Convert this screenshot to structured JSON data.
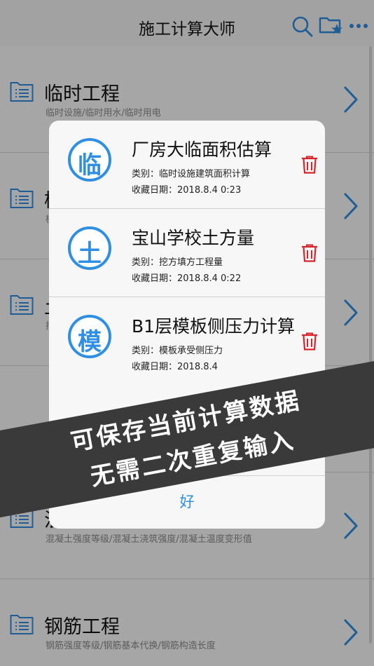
{
  "nav": {
    "title": "施工计算大师",
    "icons": [
      "search-icon",
      "folder-star-icon",
      "more-icon"
    ]
  },
  "list": [
    {
      "title": "临时工程",
      "subtitle": "临时设施/临时用水/临时用电"
    },
    {
      "title": "模",
      "subtitle": "模"
    },
    {
      "title": "土",
      "subtitle": "挖"
    },
    {
      "title": "",
      "subtitle": ""
    },
    {
      "title": "混",
      "subtitle": "混凝土强度等级/混凝土浇筑强度/混凝土温度变形值"
    },
    {
      "title": "钢筋工程",
      "subtitle": "钢筋强度等级/钢筋基本代换/钢筋构造长度"
    }
  ],
  "alert": {
    "items": [
      {
        "badge": "临",
        "name": "厂房大临面积估算",
        "category": "类别：临时设施建筑面积计算",
        "date": "收藏日期：2018.8.4 0:23"
      },
      {
        "badge": "土",
        "name": "宝山学校土方量",
        "category": "类别：挖方填方工程量",
        "date": "收藏日期：2018.8.4 0:22"
      },
      {
        "badge": "模",
        "name": "B1层模板侧压力计算",
        "category": "类别：模板承受侧压力",
        "date": "收藏日期：2018.8.4"
      }
    ],
    "ok_label": "好"
  },
  "banner": {
    "line1": "可保存当前计算数据",
    "line2": "无需二次重复输入"
  },
  "colors": {
    "accent": "#2f8fe5",
    "delete": "#d9252a",
    "banner": "#3a3a3a"
  }
}
